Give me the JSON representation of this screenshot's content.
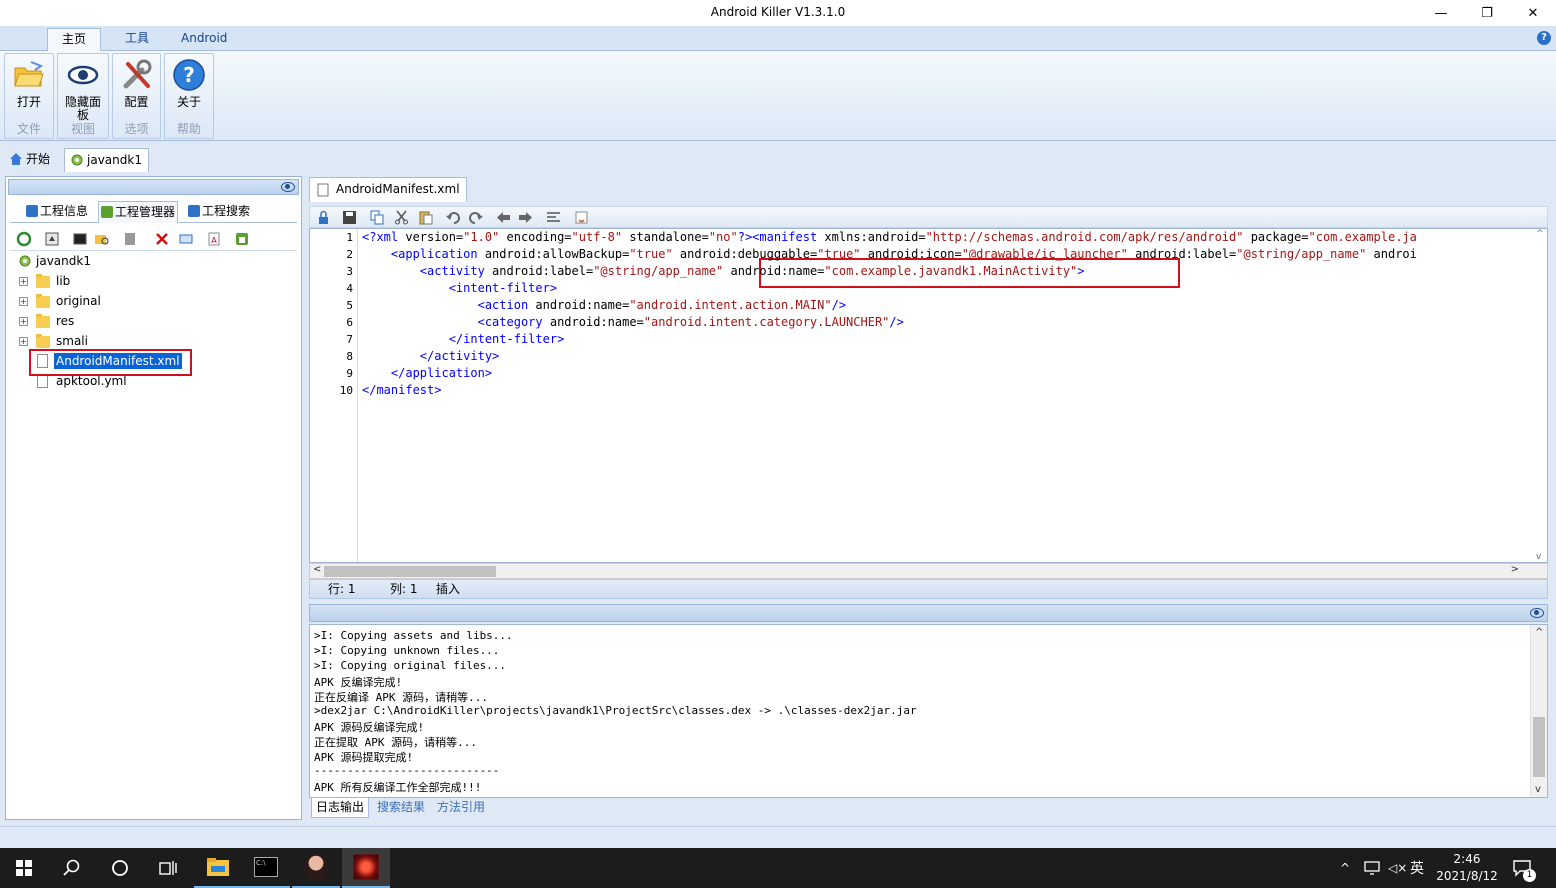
{
  "window": {
    "title": "Android Killer V1.3.1.0",
    "minimize": "—",
    "maximize": "❐",
    "close": "✕"
  },
  "ribbon_tabs": [
    "主页",
    "工具",
    "Android"
  ],
  "help_glyph": "?",
  "ribbon_groups": [
    {
      "button": "打开",
      "group": "文件",
      "icon": "folder-open-icon"
    },
    {
      "button": "隐藏面板",
      "group": "视图",
      "icon": "eye-icon"
    },
    {
      "button": "配置",
      "group": "选项",
      "icon": "tools-icon"
    },
    {
      "button": "关于",
      "group": "帮助",
      "icon": "help-icon"
    }
  ],
  "doc_tabs": [
    "开始",
    "javandk1"
  ],
  "left_tabs": [
    "工程信息",
    "工程管理器",
    "工程搜索"
  ],
  "tree": {
    "root": "javandk1",
    "folders": [
      "lib",
      "original",
      "res",
      "smali"
    ],
    "files": [
      "AndroidManifest.xml",
      "apktool.yml"
    ],
    "selected": "AndroidManifest.xml",
    "expander_glyph": "+"
  },
  "editor": {
    "tab": "AndroidManifest.xml",
    "lines": [
      {
        "n": "1",
        "segs": [
          [
            "tag",
            "<?xml "
          ],
          [
            "attr",
            "version="
          ],
          [
            "val",
            "\"1.0\""
          ],
          [
            "attr",
            " encoding="
          ],
          [
            "val",
            "\"utf-8\""
          ],
          [
            "attr",
            " standalone="
          ],
          [
            "val",
            "\"no\""
          ],
          [
            "tag",
            "?><manifest "
          ],
          [
            "attr",
            "xmlns:android="
          ],
          [
            "val",
            "\"http://schemas.android.com/apk/res/android\""
          ],
          [
            "attr",
            " package="
          ],
          [
            "val",
            "\"com.example.ja"
          ]
        ]
      },
      {
        "n": "2",
        "segs": [
          [
            "tag",
            "    <application "
          ],
          [
            "attr",
            "android:allowBackup="
          ],
          [
            "val",
            "\"true\""
          ],
          [
            "attr",
            " android:debuggable="
          ],
          [
            "val",
            "\"true\""
          ],
          [
            "attr",
            " android:icon="
          ],
          [
            "val",
            "\"@drawable/ic_launcher\""
          ],
          [
            "attr",
            " android:label="
          ],
          [
            "val",
            "\"@string/app_name\""
          ],
          [
            "attr",
            " androi"
          ]
        ]
      },
      {
        "n": "3",
        "segs": [
          [
            "tag",
            "        <activity "
          ],
          [
            "attr",
            "android:label="
          ],
          [
            "val",
            "\"@string/app_name\""
          ],
          [
            "attr",
            " android:name="
          ],
          [
            "val",
            "\"com.example.javandk1.MainActivity\""
          ],
          [
            "tag",
            ">"
          ]
        ]
      },
      {
        "n": "4",
        "segs": [
          [
            "tag",
            "            <intent-filter>"
          ]
        ]
      },
      {
        "n": "5",
        "segs": [
          [
            "tag",
            "                <action "
          ],
          [
            "attr",
            "android:name="
          ],
          [
            "val",
            "\"android.intent.action.MAIN\""
          ],
          [
            "tag",
            "/>"
          ]
        ]
      },
      {
        "n": "6",
        "segs": [
          [
            "tag",
            "                <category "
          ],
          [
            "attr",
            "android:name="
          ],
          [
            "val",
            "\"android.intent.category.LAUNCHER\""
          ],
          [
            "tag",
            "/>"
          ]
        ]
      },
      {
        "n": "7",
        "segs": [
          [
            "tag",
            "            </intent-filter>"
          ]
        ]
      },
      {
        "n": "8",
        "segs": [
          [
            "tag",
            "        </activity>"
          ]
        ]
      },
      {
        "n": "9",
        "segs": [
          [
            "tag",
            "    </application>"
          ]
        ]
      },
      {
        "n": "10",
        "segs": [
          [
            "tag",
            "</manifest>"
          ]
        ]
      }
    ],
    "status_row": "行: 1",
    "status_col": "列: 1",
    "status_mode": "插入",
    "scroll_left": "<",
    "scroll_right": ">",
    "scroll_up": "^",
    "scroll_down": "v"
  },
  "log": {
    "lines": [
      ">I: Copying assets and libs...",
      ">I: Copying unknown files...",
      ">I: Copying original files...",
      "APK 反编译完成!",
      "正在反编译 APK 源码，请稍等...",
      ">dex2jar C:\\AndroidKiller\\projects\\javandk1\\ProjectSrc\\classes.dex -> .\\classes-dex2jar.jar",
      "APK 源码反编译完成!",
      "正在提取 APK 源码，请稍等...",
      "APK 源码提取完成!",
      "----------------------------",
      "APK 所有反编译工作全部完成!!!"
    ],
    "tabs": [
      "日志输出",
      "搜索结果",
      "方法引用"
    ],
    "scroll_up": "^",
    "scroll_down": "v"
  },
  "taskbar": {
    "time": "2:46",
    "date": "2021/8/12",
    "ime": "英",
    "notify_count": "1",
    "chevron": "^",
    "volume": "◁×",
    "cmd_glyph": "C:\\"
  }
}
